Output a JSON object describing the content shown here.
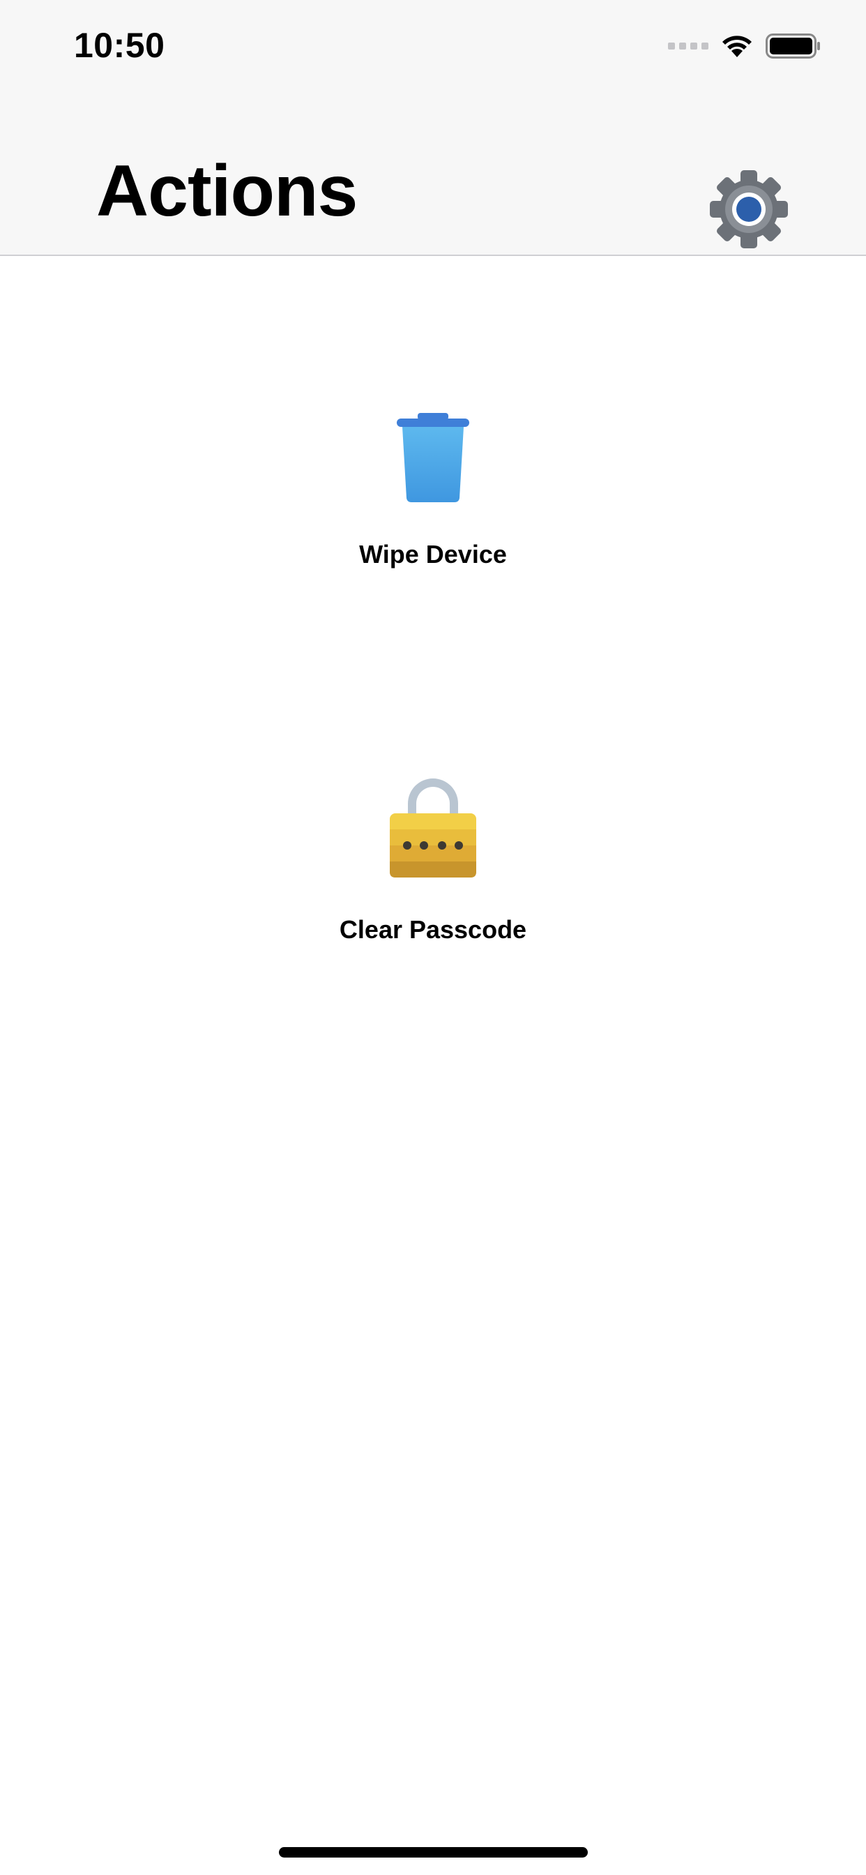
{
  "status_bar": {
    "time": "10:50",
    "icons": [
      "cellular-signal-icon",
      "wifi-icon",
      "battery-icon"
    ]
  },
  "header": {
    "title": "Actions",
    "settings_icon": "gear-icon"
  },
  "actions": [
    {
      "label": "Wipe Device",
      "icon": "trash-icon"
    },
    {
      "label": "Clear Passcode",
      "icon": "padlock-icon"
    }
  ],
  "colors": {
    "header_background": "#f7f7f7",
    "trash_blue": "#4aa3e6",
    "lock_yellow": "#f2cf47",
    "gear_gray": "#6c7178",
    "gear_center_blue": "#2c5fab"
  }
}
